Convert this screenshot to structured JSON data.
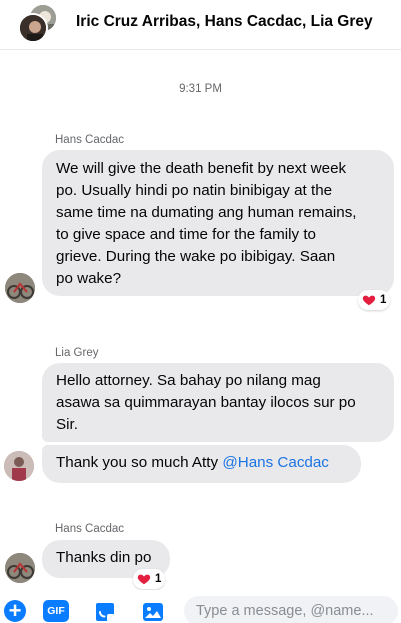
{
  "header": {
    "title": "Iric Cruz Arribas, Hans Cacdac, Lia Grey"
  },
  "conversation": {
    "timestamp": "9:31 PM",
    "messages": [
      {
        "sender": "Hans Cacdac",
        "lines": [
          "We will give the death benefit by next week",
          "po. Usually hindi po natin binibigay at the",
          "same time na dumating ang human remains,",
          "to give space and time for the family to",
          "grieve.  During the wake po ibibigay. Saan",
          "po wake?"
        ],
        "reaction": {
          "emoji": "heart",
          "count": "1"
        }
      },
      {
        "sender": "Lia Grey",
        "lines": [
          "Hello attorney.  Sa bahay po nilang mag",
          "asawa sa quimmarayan bantay ilocos sur po",
          "Sir."
        ]
      },
      {
        "sender": "",
        "text_prefix": "Thank you so much Atty ",
        "mention": "@Hans Cacdac"
      },
      {
        "sender": "Hans Cacdac",
        "text": "Thanks din po",
        "reaction": {
          "emoji": "heart",
          "count": "1"
        }
      }
    ]
  },
  "composer": {
    "placeholder": "Type a message, @name...",
    "gif_label": "GIF",
    "plus_label": "+",
    "accent_color": "#0a7cff"
  },
  "colors": {
    "bubble_bg": "#e9e9ec",
    "mention": "#1b74e4",
    "heart": "#e41e3f"
  }
}
